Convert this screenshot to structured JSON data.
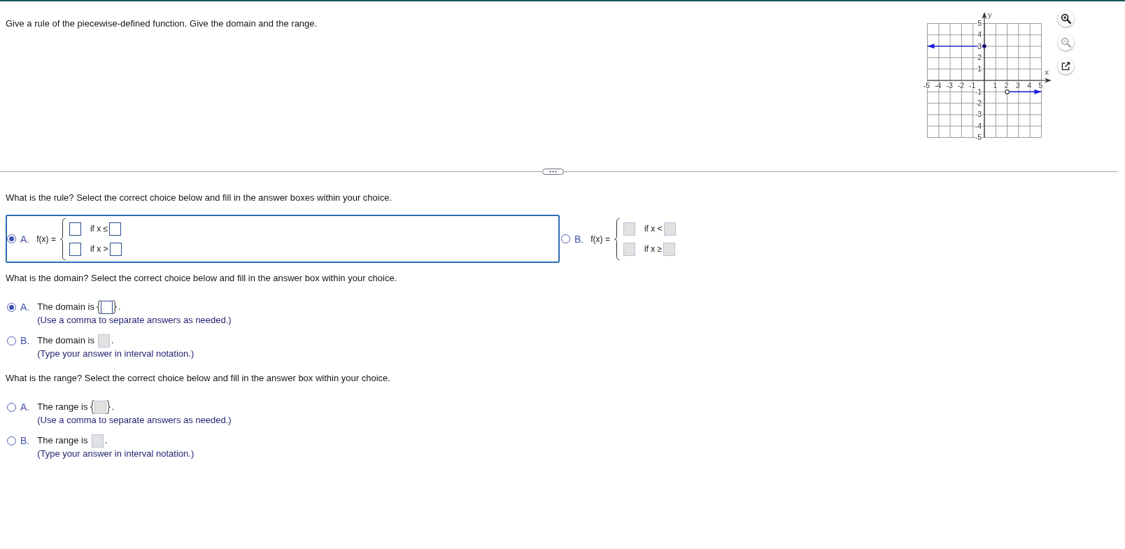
{
  "question": "Give a rule of the piecewise-defined function. Give the domain and the range.",
  "graph": {
    "chart_data": {
      "type": "line",
      "xlabel": "x",
      "ylabel": "y",
      "x": [
        -5,
        0,
        2,
        5
      ],
      "series": [
        {
          "color": "#1c1cdc",
          "values": [
            3,
            3,
            null,
            null
          ]
        },
        {
          "color": "#1c1cdc",
          "values": [
            null,
            null,
            -1,
            -1
          ]
        }
      ],
      "xlim": [
        -5,
        5
      ],
      "ylim": [
        -5,
        5
      ],
      "xticks": [
        -5,
        -4,
        -3,
        -2,
        -1,
        1,
        2,
        3,
        4,
        5
      ],
      "yticks": [
        -5,
        -4,
        -3,
        -2,
        -1,
        1,
        2,
        3,
        4,
        5
      ],
      "grid": true
    },
    "pieces": [
      {
        "ends": [
          {
            "kind": "arrow"
          },
          {
            "kind": "closed-dot"
          }
        ]
      },
      {
        "ends": [
          {
            "kind": "open-dot"
          },
          {
            "kind": "arrow"
          }
        ]
      }
    ],
    "tools": [
      {
        "kind": "zoom-in",
        "disabled": false
      },
      {
        "kind": "zoom-out",
        "disabled": true
      },
      {
        "kind": "pop-out",
        "disabled": false
      }
    ]
  },
  "rule": {
    "prompt": "What is the rule? Select the correct choice below and fill in the answer boxes within your choice.",
    "choices": [
      {
        "letter": "A.",
        "selected": true,
        "focused": true,
        "lhs": "f(x) =",
        "cases": [
          {
            "condition": "if x ≤"
          },
          {
            "condition": "if x >"
          }
        ]
      },
      {
        "letter": "B.",
        "selected": false,
        "focused": false,
        "lhs": "f(x) =",
        "cases": [
          {
            "condition": "if x <"
          },
          {
            "condition": "if x ≥"
          }
        ]
      }
    ]
  },
  "domain": {
    "prompt": "What is the domain? Select the correct choice below and fill in the answer box within your choice.",
    "choices": [
      {
        "letter": "A.",
        "selected": true,
        "kind": "set",
        "text": "The domain is",
        "end": ".",
        "hint": "(Use a comma to separate answers as needed.)"
      },
      {
        "letter": "B.",
        "selected": false,
        "kind": "interval",
        "text": "The domain is",
        "end": ".",
        "hint": "(Type your answer in interval notation.)"
      }
    ]
  },
  "range": {
    "prompt": "What is the range? Select the correct choice below and fill in the answer box within your choice.",
    "choices": [
      {
        "letter": "A.",
        "selected": false,
        "kind": "set",
        "text": "The range is",
        "end": ".",
        "hint": "(Use a comma to separate answers as needed.)"
      },
      {
        "letter": "B.",
        "selected": false,
        "kind": "interval",
        "text": "The range is",
        "end": ".",
        "hint": "(Type your answer in interval notation.)"
      }
    ]
  }
}
